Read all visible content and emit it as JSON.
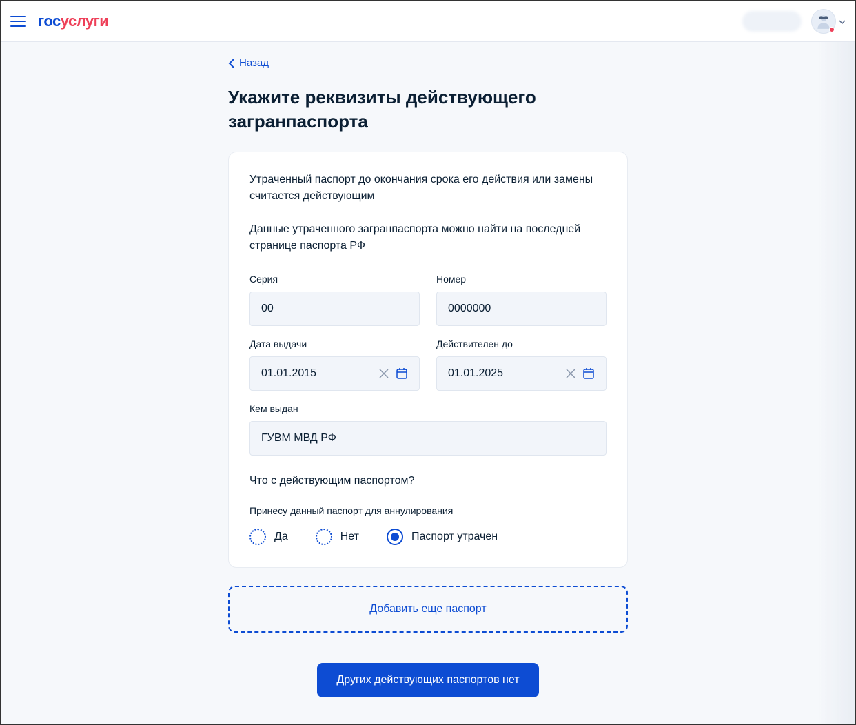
{
  "header": {
    "logo_part1": "гос",
    "logo_part2": "услуги"
  },
  "nav": {
    "back_label": "Назад"
  },
  "title": "Укажите реквизиты действующего загранпаспорта",
  "card": {
    "info1": "Утраченный паспорт до окончания срока его действия или замены считается действующим",
    "info2": "Данные утраченного загранпаспорта можно найти на последней странице паспорта РФ",
    "fields": {
      "series": {
        "label": "Серия",
        "value": "00"
      },
      "number": {
        "label": "Номер",
        "value": "0000000"
      },
      "issue_date": {
        "label": "Дата выдачи",
        "value": "01.01.2015"
      },
      "expiry_date": {
        "label": "Действителен до",
        "value": "01.01.2025"
      },
      "issued_by": {
        "label": "Кем выдан",
        "value": "ГУВМ МВД РФ"
      }
    },
    "question": "Что с действующим паспортом?",
    "sublabel": "Принесу данный паспорт для аннулирования",
    "radios": {
      "yes": "Да",
      "no": "Нет",
      "lost": "Паспорт утрачен"
    }
  },
  "buttons": {
    "add_more": "Добавить еще паспорт",
    "no_other": "Других действующих паспортов нет"
  }
}
